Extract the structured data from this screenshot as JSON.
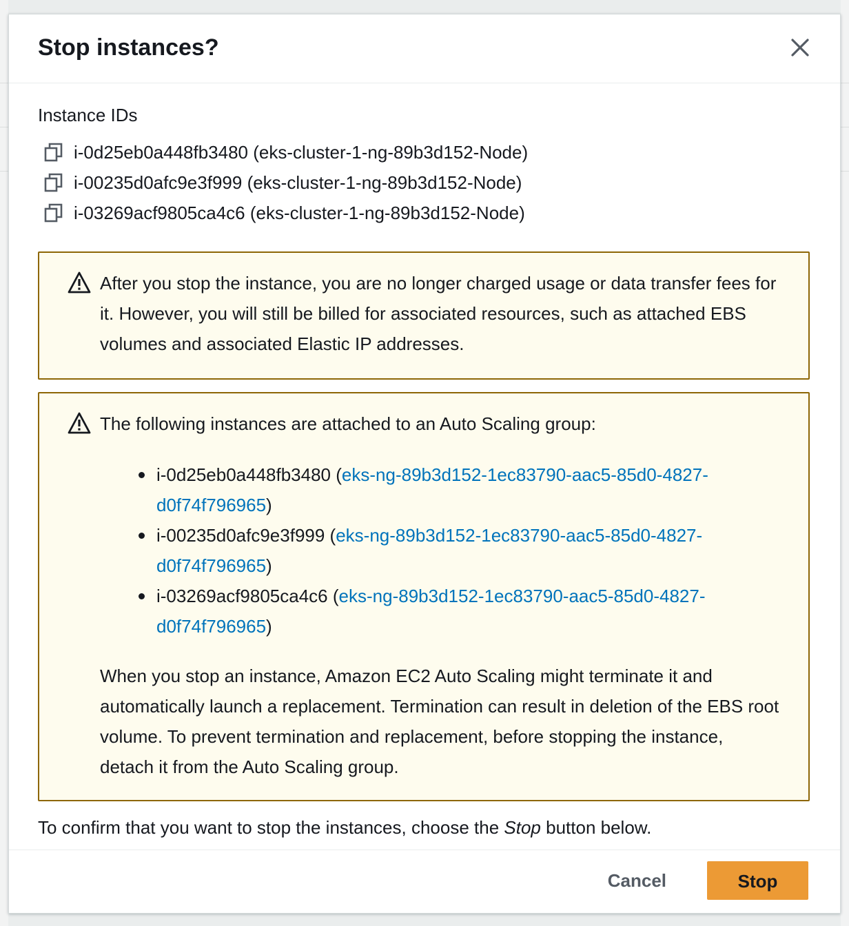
{
  "dialog": {
    "title": "Stop instances?",
    "close_icon": "close-icon",
    "instance_ids_label": "Instance IDs",
    "instances": [
      {
        "id": "i-0d25eb0a448fb3480",
        "name": "(eks-cluster-1-ng-89b3d152-Node)"
      },
      {
        "id": "i-00235d0afc9e3f999",
        "name": "(eks-cluster-1-ng-89b3d152-Node)"
      },
      {
        "id": "i-03269acf9805ca4c6",
        "name": "(eks-cluster-1-ng-89b3d152-Node)"
      }
    ],
    "billing_alert": {
      "icon": "warning-icon",
      "text": "After you stop the instance, you are no longer charged usage or data transfer fees for it. However, you will still be billed for associated resources, such as attached EBS volumes and associated Elastic IP addresses."
    },
    "asg_alert": {
      "icon": "warning-icon",
      "heading": "The following instances are attached to an Auto Scaling group:",
      "items": [
        {
          "instance": "i-0d25eb0a448fb3480",
          "group": "eks-ng-89b3d152-1ec83790-aac5-85d0-4827-d0f74f796965"
        },
        {
          "instance": "i-00235d0afc9e3f999",
          "group": "eks-ng-89b3d152-1ec83790-aac5-85d0-4827-d0f74f796965"
        },
        {
          "instance": "i-03269acf9805ca4c6",
          "group": "eks-ng-89b3d152-1ec83790-aac5-85d0-4827-d0f74f796965"
        }
      ],
      "note": "When you stop an instance, Amazon EC2 Auto Scaling might terminate it and automatically launch a replacement. Termination can result in deletion of the EBS root volume. To prevent termination and replacement, before stopping the instance, detach it from the Auto Scaling group."
    },
    "confirm_text_before": "To confirm that you want to stop the instances, choose the ",
    "confirm_text_emphasis": "Stop",
    "confirm_text_after": " button below.",
    "cancel_label": "Cancel",
    "stop_label": "Stop"
  },
  "colors": {
    "accent_button": "#ec9a35",
    "warning_border": "#8d6605",
    "warning_background": "#fefcee",
    "link": "#0073bb"
  }
}
